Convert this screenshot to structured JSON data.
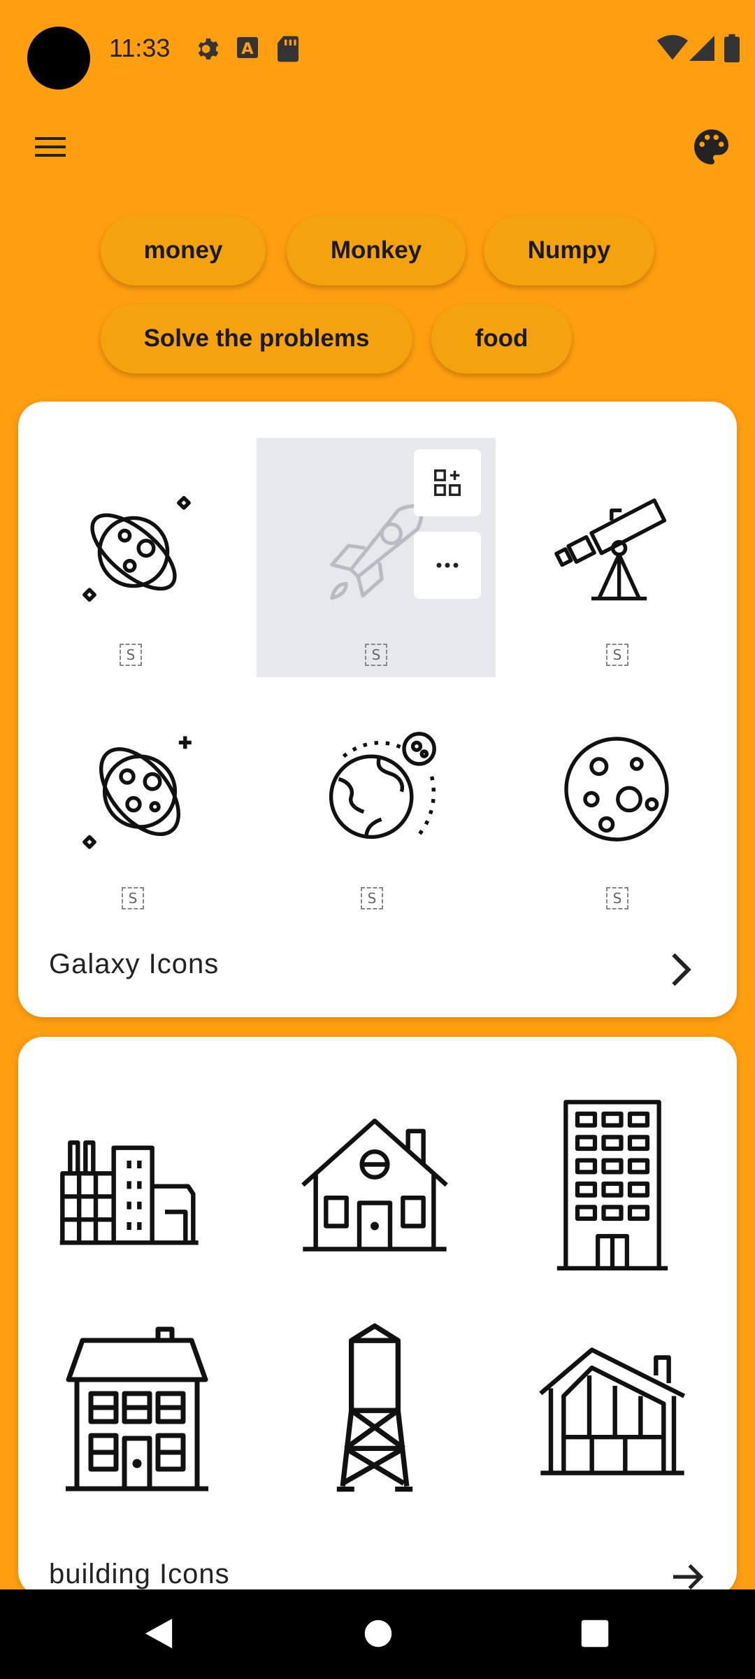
{
  "status_bar": {
    "time": "11:33",
    "icons": [
      "settings-icon",
      "a-letter-icon",
      "sd-card-icon",
      "wifi-icon",
      "signal-icon",
      "battery-icon"
    ]
  },
  "app_bar": {
    "menu_icon": "hamburger-menu-icon",
    "theme_icon": "palette-icon"
  },
  "chips": [
    "money",
    "Monkey",
    "Numpy",
    "Solve the problems",
    "food"
  ],
  "cards": [
    {
      "title": "Galaxy Icons",
      "icons": [
        "planet-icon",
        "rocket-icon",
        "telescope-icon",
        "planet-stars-icon",
        "earth-moon-icon",
        "moon-icon"
      ],
      "badge": "S",
      "hover_actions": [
        "add-to-collection-icon",
        "more-options-icon"
      ]
    },
    {
      "title": "building Icons",
      "icons": [
        "factory-icon",
        "house-icon",
        "office-building-icon",
        "townhouse-icon",
        "water-tower-icon",
        "modern-house-icon"
      ]
    }
  ],
  "colors": {
    "background": "#FF9E0F",
    "chip": "#F5A20F",
    "card": "#FFFFFF"
  }
}
